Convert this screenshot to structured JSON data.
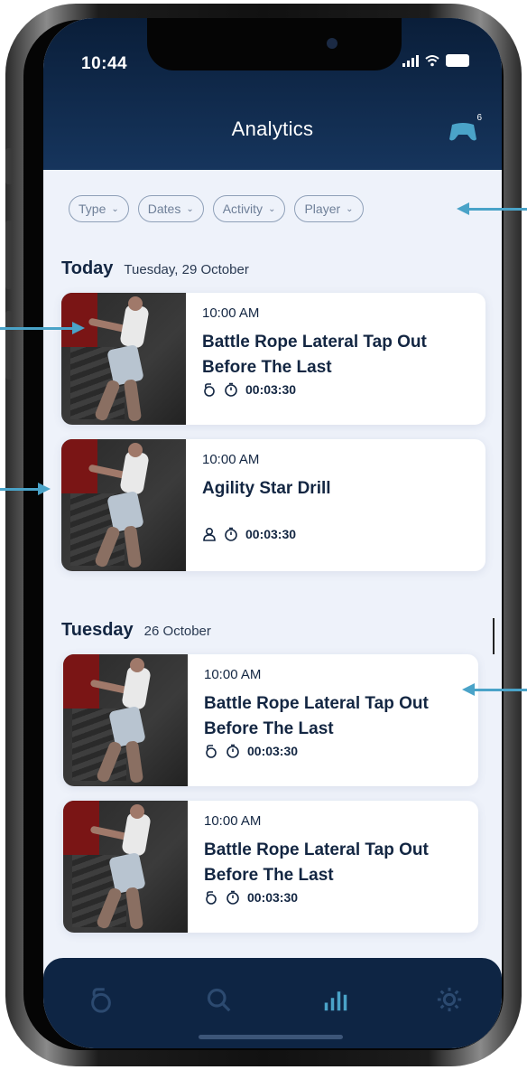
{
  "status_bar": {
    "time": "10:44"
  },
  "header": {
    "title": "Analytics",
    "controller_badge": "6"
  },
  "filters": [
    {
      "label": "Type"
    },
    {
      "label": "Dates"
    },
    {
      "label": "Activity"
    },
    {
      "label": "Player"
    }
  ],
  "sections": [
    {
      "day": "Today",
      "date": "Tuesday, 29 October",
      "cards": [
        {
          "time": "10:00 AM",
          "title": "Battle Rope Lateral Tap Out Before The Last",
          "meta_icon": "kettlebell-icon",
          "duration": "00:03:30"
        },
        {
          "time": "10:00 AM",
          "title": "Agility Star Drill",
          "meta_icon": "person-icon",
          "duration": "00:03:30"
        }
      ]
    },
    {
      "day": "Tuesday",
      "date": "26 October",
      "cards": [
        {
          "time": "10:00 AM",
          "title": "Battle Rope Lateral Tap Out Before The Last",
          "meta_icon": "kettlebell-icon",
          "duration": "00:03:30"
        },
        {
          "time": "10:00 AM",
          "title": "Battle Rope Lateral Tap Out Before The Last",
          "meta_icon": "kettlebell-icon",
          "duration": "00:03:30"
        }
      ]
    }
  ],
  "bottom_nav": [
    {
      "icon": "kettlebell-icon",
      "active": false
    },
    {
      "icon": "search-icon",
      "active": false
    },
    {
      "icon": "analytics-icon",
      "active": true
    },
    {
      "icon": "settings-icon",
      "active": false
    }
  ],
  "colors": {
    "header": "#0a1e39",
    "accent": "#4aa3c8",
    "text": "#132642",
    "background": "#eef2fa"
  }
}
